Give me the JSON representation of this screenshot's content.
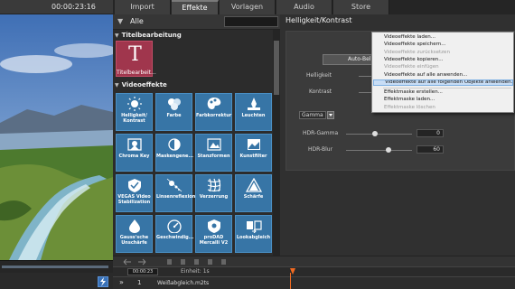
{
  "app": {
    "timecode": "00:00:23:16"
  },
  "tabs": [
    "Import",
    "Effekte",
    "Vorlagen",
    "Audio",
    "Store"
  ],
  "active_tab": "Effekte",
  "filter": {
    "value": "Alle"
  },
  "sections": {
    "titles": "Titelbearbeitung",
    "video": "Videoeffekte"
  },
  "title_tile": {
    "glyph": "T",
    "label": "Titelbearbeit..."
  },
  "effect_tiles": [
    {
      "label": "Helligkeit/\nKontrast",
      "icon": "brightness-icon"
    },
    {
      "label": "Farbe",
      "icon": "color-icon"
    },
    {
      "label": "Farbkorrektur",
      "icon": "palette-icon"
    },
    {
      "label": "Leuchten",
      "icon": "glow-icon"
    },
    {
      "label": "Chroma Key",
      "icon": "chroma-key-icon"
    },
    {
      "label": "Maskengene...",
      "icon": "mask-icon"
    },
    {
      "label": "Stanzformen",
      "icon": "shapes-icon"
    },
    {
      "label": "Kunstfilter",
      "icon": "art-filter-icon"
    },
    {
      "label": "VEGAS Video\nStabilization",
      "icon": "stabilization-icon"
    },
    {
      "label": "Linsenreflexion",
      "icon": "lens-flare-icon"
    },
    {
      "label": "Verzerrung",
      "icon": "distortion-icon"
    },
    {
      "label": "Schärfe",
      "icon": "sharpness-icon"
    },
    {
      "label": "Gauss'sche\nUnschärfe",
      "icon": "blur-icon"
    },
    {
      "label": "Geschwindig...",
      "icon": "speed-icon"
    },
    {
      "label": "proDAD\nMercalli V2",
      "icon": "mercalli-icon"
    },
    {
      "label": "Lookabgleich",
      "icon": "look-match-icon"
    }
  ],
  "properties": {
    "title": "Helligkeit/Kontrast",
    "side_button": "fx",
    "auto_button": "Auto-Belich",
    "brightness_label": "Helligkeit",
    "contrast_label": "Kontrast",
    "gamma_label": "Gamma",
    "hdr_gamma_label": "HDR-Gamma",
    "hdr_gamma_value": "0",
    "hdr_blur_label": "HDR-Blur",
    "hdr_blur_value": "60"
  },
  "context_menu": [
    {
      "label": "Videoeffekte laden...",
      "state": "normal"
    },
    {
      "label": "Videoeffekte speichern...",
      "state": "normal"
    },
    {
      "label": "Videoeffekte zurücksetzen",
      "state": "disabled"
    },
    {
      "label": "Videoeffekte kopieren...",
      "state": "normal"
    },
    {
      "label": "Videoeffekte einfügen",
      "state": "disabled"
    },
    {
      "label": "Videoeffekte auf alle anwenden...",
      "state": "normal"
    },
    {
      "label": "Videoeffekte auf alle folgenden Objekte anwenden...",
      "state": "highlight"
    },
    {
      "label": "Effektmaske erstellen...",
      "state": "normal"
    },
    {
      "label": "Effektmaske laden...",
      "state": "normal"
    },
    {
      "label": "Effektmaske löschen",
      "state": "disabled"
    }
  ],
  "timeline": {
    "time": "00:00:23",
    "unit_label": "Einheit: 1s",
    "track_number": "1",
    "track_name": "Weißabgleich.m2ts"
  }
}
